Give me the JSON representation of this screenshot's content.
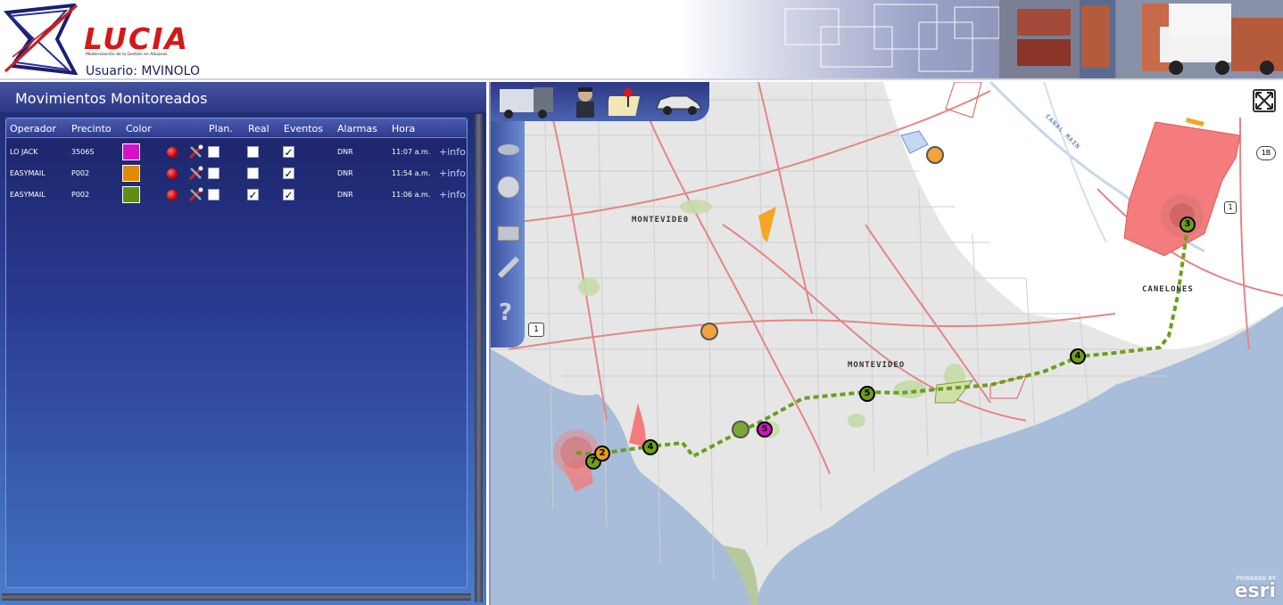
{
  "header": {
    "brand": "LUCIA",
    "brand_sub": "Modernización de la Gestión en Aduanas",
    "user": "Usuario: MVINOLO"
  },
  "panel": {
    "title": "Movimientos Monitoreados",
    "columns": [
      "Operador",
      "Precinto",
      "Color",
      "Plan.",
      "Real",
      "Eventos",
      "Alarmas",
      "Hora"
    ],
    "rows": [
      {
        "operador": "LO JACK",
        "precinto": "3506S",
        "color": "#d612c8",
        "plan": false,
        "real": false,
        "eventos": true,
        "alarmas": "DNR",
        "hora": "11:07 a.m.",
        "info": "+info"
      },
      {
        "operador": "EASYMAIL",
        "precinto": "P002",
        "color": "#e08a00",
        "plan": false,
        "real": false,
        "eventos": true,
        "alarmas": "DNR",
        "hora": "11:54 a.m.",
        "info": "+info"
      },
      {
        "operador": "EASYMAIL",
        "precinto": "P002",
        "color": "#5f8f10",
        "plan": false,
        "real": true,
        "eventos": true,
        "alarmas": "DNR",
        "hora": "11:06 a.m.",
        "info": "+info"
      }
    ]
  },
  "map": {
    "labels": {
      "montevideo0": "MONTEVIDE0",
      "montevideo": "MONTEVIDEO",
      "canelones": "CANELONES",
      "canal": "CANAL MAIN"
    },
    "route_markers": [
      "3",
      "4",
      "5",
      "4",
      "7",
      "2",
      "5"
    ],
    "road_shields": [
      "1",
      "1",
      "1B"
    ],
    "help": "?",
    "esri_powered": "POWERED BY",
    "esri": "esri"
  }
}
